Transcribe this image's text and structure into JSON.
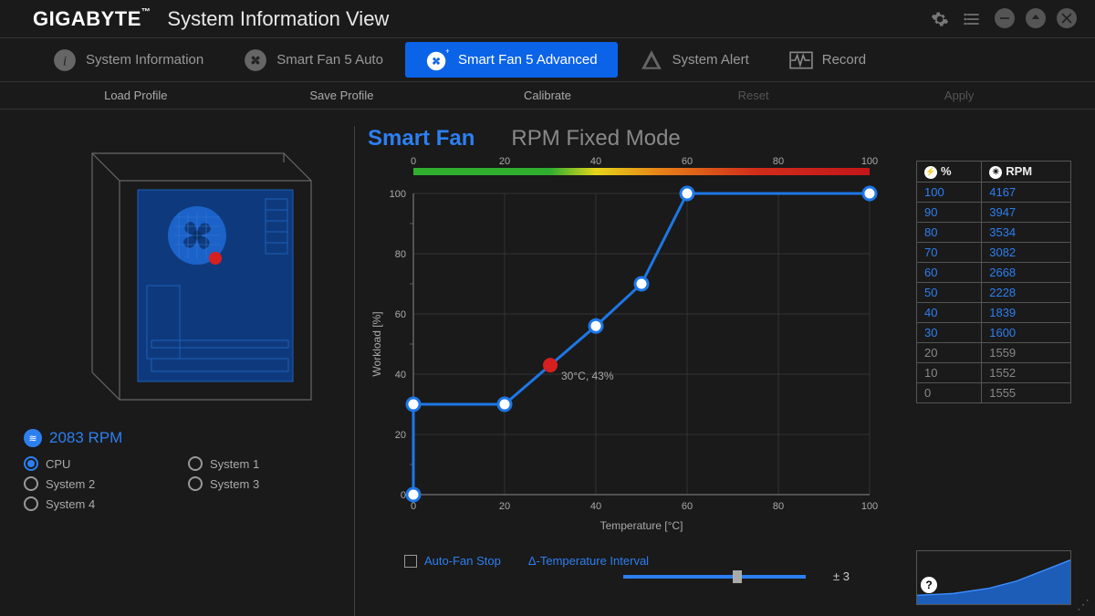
{
  "brand": "GIGABYTE",
  "app_title": "System Information View",
  "tabs": {
    "sysinfo": "System Information",
    "smartauto": "Smart Fan 5 Auto",
    "smartadv": "Smart Fan 5 Advanced",
    "alert": "System Alert",
    "record": "Record"
  },
  "subbar": {
    "load": "Load Profile",
    "save": "Save Profile",
    "calibrate": "Calibrate",
    "reset": "Reset",
    "apply": "Apply"
  },
  "left": {
    "current_rpm": "2083 RPM",
    "sensors": {
      "cpu": "CPU",
      "sys1": "System 1",
      "sys2": "System 2",
      "sys3": "System 3",
      "sys4": "System 4"
    }
  },
  "modes": {
    "smart": "Smart Fan",
    "rpm": "RPM Fixed Mode"
  },
  "chart_data": {
    "type": "line",
    "xlabel": "Temperature [°C]",
    "ylabel": "Workload [%]",
    "xlim": [
      0,
      100
    ],
    "ylim": [
      0,
      100
    ],
    "x_ticks": [
      0,
      20,
      40,
      60,
      80,
      100
    ],
    "y_ticks": [
      0,
      20,
      40,
      60,
      80,
      100
    ],
    "points": [
      {
        "x": 0,
        "y": 0
      },
      {
        "x": 0,
        "y": 30
      },
      {
        "x": 20,
        "y": 30
      },
      {
        "x": 40,
        "y": 56
      },
      {
        "x": 50,
        "y": 70
      },
      {
        "x": 60,
        "y": 100
      },
      {
        "x": 100,
        "y": 100
      }
    ],
    "current": {
      "x": 30,
      "y": 43,
      "label": "30°C, 43%"
    },
    "gradient_ticks": [
      0,
      20,
      40,
      60,
      80,
      100
    ]
  },
  "footer": {
    "auto_stop": "Auto-Fan Stop",
    "dtemp_label": "Δ-Temperature Interval",
    "dtemp_value": "± 3"
  },
  "rpm_table": {
    "headers": {
      "pct": "%",
      "rpm": "RPM"
    },
    "rows": [
      {
        "pct": "100",
        "rpm": "4167",
        "dim": false
      },
      {
        "pct": "90",
        "rpm": "3947",
        "dim": false
      },
      {
        "pct": "80",
        "rpm": "3534",
        "dim": false
      },
      {
        "pct": "70",
        "rpm": "3082",
        "dim": false
      },
      {
        "pct": "60",
        "rpm": "2668",
        "dim": false
      },
      {
        "pct": "50",
        "rpm": "2228",
        "dim": false
      },
      {
        "pct": "40",
        "rpm": "1839",
        "dim": false
      },
      {
        "pct": "30",
        "rpm": "1600",
        "dim": false
      },
      {
        "pct": "20",
        "rpm": "1559",
        "dim": true
      },
      {
        "pct": "10",
        "rpm": "1552",
        "dim": true
      },
      {
        "pct": "0",
        "rpm": "1555",
        "dim": true
      }
    ]
  }
}
